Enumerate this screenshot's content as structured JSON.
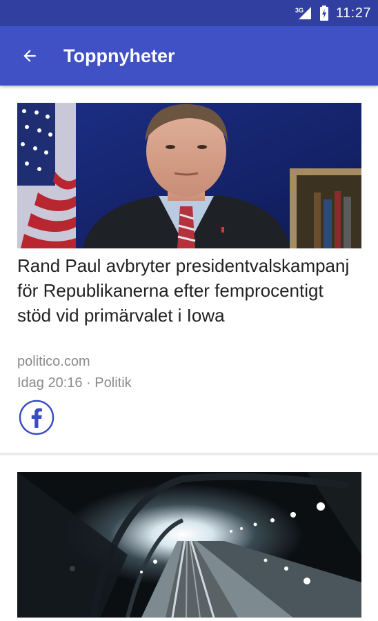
{
  "status_bar": {
    "network": "3G",
    "time": "11:27"
  },
  "toolbar": {
    "back_icon": "arrow-back-icon",
    "title": "Toppnyheter"
  },
  "articles": [
    {
      "image": "politician-photo",
      "headline": "Rand Paul avbryter presidentvalskampanj för Republikanerna efter femprocentigt stöd vid primärvalet i Iowa",
      "source": "politico.com",
      "meta": "Idag 20:16 · Politik",
      "share_icon": "facebook-icon"
    },
    {
      "image": "tunnel-photo"
    }
  ],
  "colors": {
    "status_bar": "#3140a0",
    "toolbar": "#3f51c5",
    "facebook_blue": "#3a4cc0",
    "secondary_text": "#8a8a8a"
  }
}
